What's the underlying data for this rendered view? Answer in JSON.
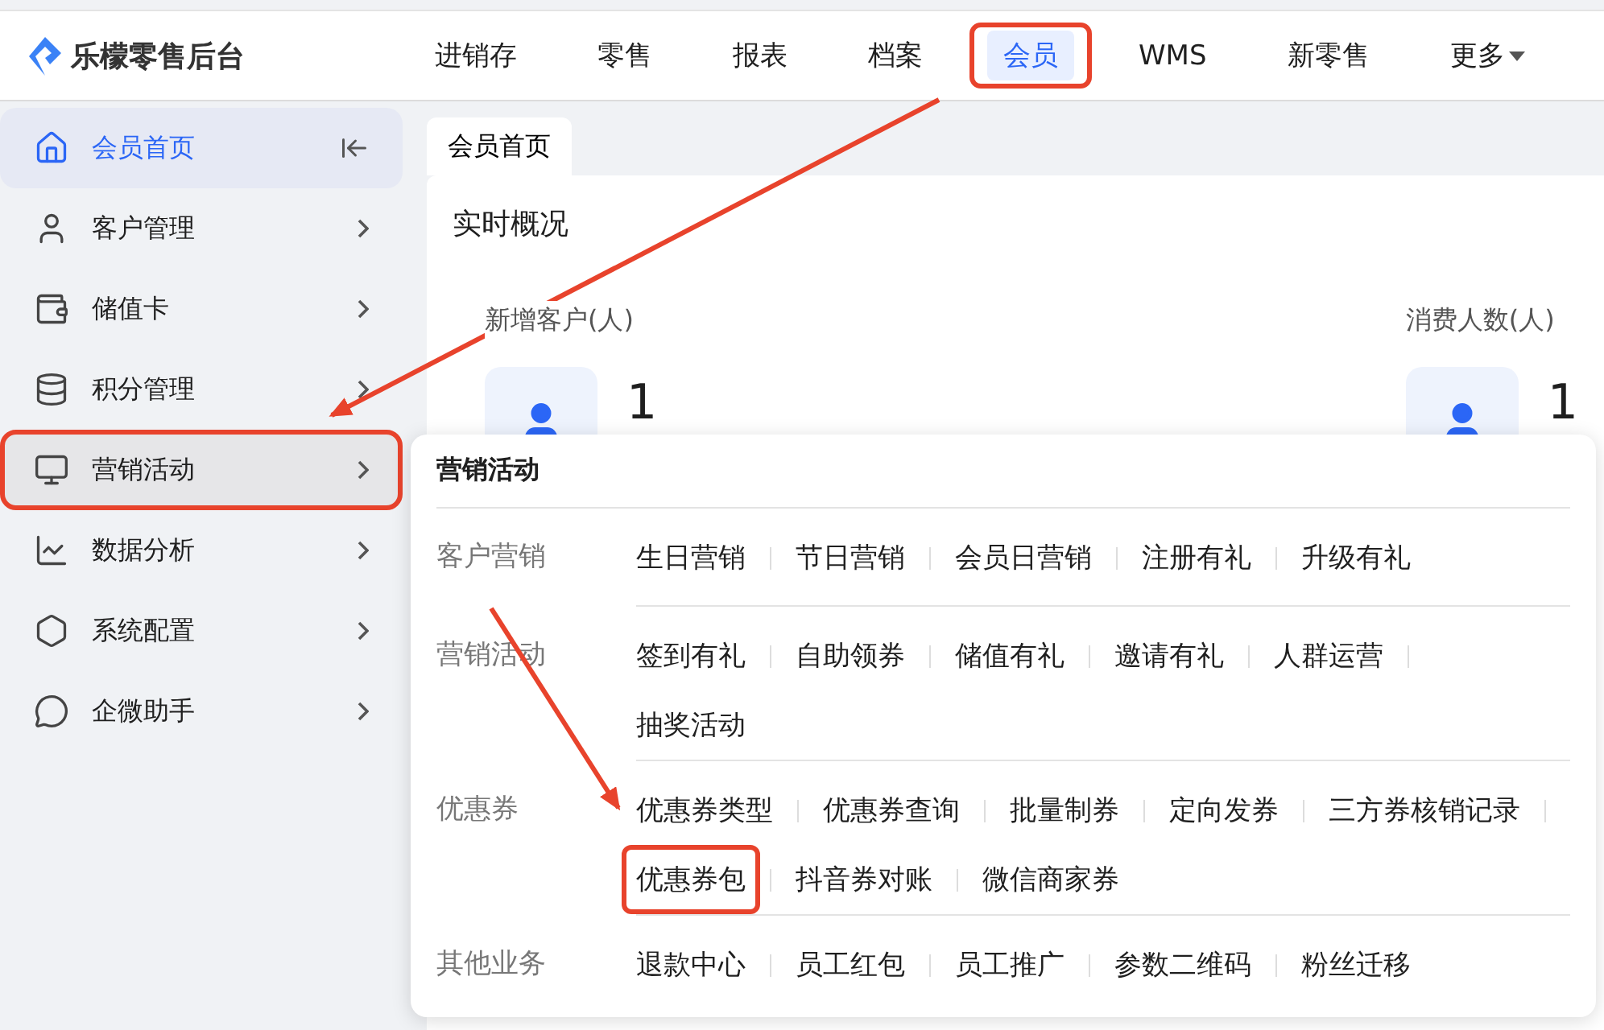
{
  "app": {
    "title": "乐檬零售后台"
  },
  "nav": [
    {
      "label": "进销存",
      "selected": false,
      "highlighted": false
    },
    {
      "label": "零售",
      "selected": false,
      "highlighted": false
    },
    {
      "label": "报表",
      "selected": false,
      "highlighted": false
    },
    {
      "label": "档案",
      "selected": false,
      "highlighted": false
    },
    {
      "label": "会员",
      "selected": true,
      "highlighted": true
    },
    {
      "label": "WMS",
      "selected": false,
      "highlighted": false
    },
    {
      "label": "新零售",
      "selected": false,
      "highlighted": false
    },
    {
      "label": "更多",
      "selected": false,
      "highlighted": false,
      "dropdown": true
    }
  ],
  "sidebar": {
    "items": [
      {
        "label": "会员首页",
        "selected": true,
        "open": false,
        "highlighted": false
      },
      {
        "label": "客户管理",
        "selected": false,
        "open": false,
        "highlighted": false
      },
      {
        "label": "储值卡",
        "selected": false,
        "open": false,
        "highlighted": false
      },
      {
        "label": "积分管理",
        "selected": false,
        "open": false,
        "highlighted": false
      },
      {
        "label": "营销活动",
        "selected": false,
        "open": true,
        "highlighted": true
      },
      {
        "label": "数据分析",
        "selected": false,
        "open": false,
        "highlighted": false
      },
      {
        "label": "系统配置",
        "selected": false,
        "open": false,
        "highlighted": false
      },
      {
        "label": "企微助手",
        "selected": false,
        "open": false,
        "highlighted": false
      }
    ]
  },
  "tabs": [
    {
      "label": "会员首页",
      "selected": true
    }
  ],
  "overview": {
    "title": "实时概况",
    "stats": [
      {
        "label": "新增客户(人)",
        "value": "1"
      },
      {
        "label": "消费人数(人)",
        "value": "1"
      }
    ]
  },
  "flyout": {
    "title": "营销活动",
    "groups": [
      {
        "label": "客户营销",
        "lines": [
          [
            {
              "label": "生日营销",
              "highlighted": false
            },
            {
              "label": "节日营销",
              "highlighted": false
            },
            {
              "label": "会员日营销",
              "highlighted": false
            },
            {
              "label": "注册有礼",
              "highlighted": false
            },
            {
              "label": "升级有礼",
              "highlighted": false
            }
          ]
        ]
      },
      {
        "label": "营销活动",
        "lines": [
          [
            {
              "label": "签到有礼",
              "highlighted": false
            },
            {
              "label": "自助领券",
              "highlighted": false
            },
            {
              "label": "储值有礼",
              "highlighted": false
            },
            {
              "label": "邀请有礼",
              "highlighted": false
            },
            {
              "label": "人群运营",
              "highlighted": false
            }
          ],
          [
            {
              "label": "抽奖活动",
              "highlighted": false
            }
          ]
        ]
      },
      {
        "label": "优惠券",
        "lines": [
          [
            {
              "label": "优惠券类型",
              "highlighted": false
            },
            {
              "label": "优惠券查询",
              "highlighted": false
            },
            {
              "label": "批量制券",
              "highlighted": false
            },
            {
              "label": "定向发券",
              "highlighted": false
            },
            {
              "label": "三方券核销记录",
              "highlighted": false
            }
          ],
          [
            {
              "label": "优惠券包",
              "highlighted": true
            },
            {
              "label": "抖音券对账",
              "highlighted": false
            },
            {
              "label": "微信商家券",
              "highlighted": false
            }
          ]
        ]
      },
      {
        "label": "其他业务",
        "lines": [
          [
            {
              "label": "退款中心",
              "highlighted": false
            },
            {
              "label": "员工红包",
              "highlighted": false
            },
            {
              "label": "员工推广",
              "highlighted": false
            },
            {
              "label": "参数二维码",
              "highlighted": false
            },
            {
              "label": "粉丝迁移",
              "highlighted": false
            }
          ]
        ]
      }
    ]
  }
}
